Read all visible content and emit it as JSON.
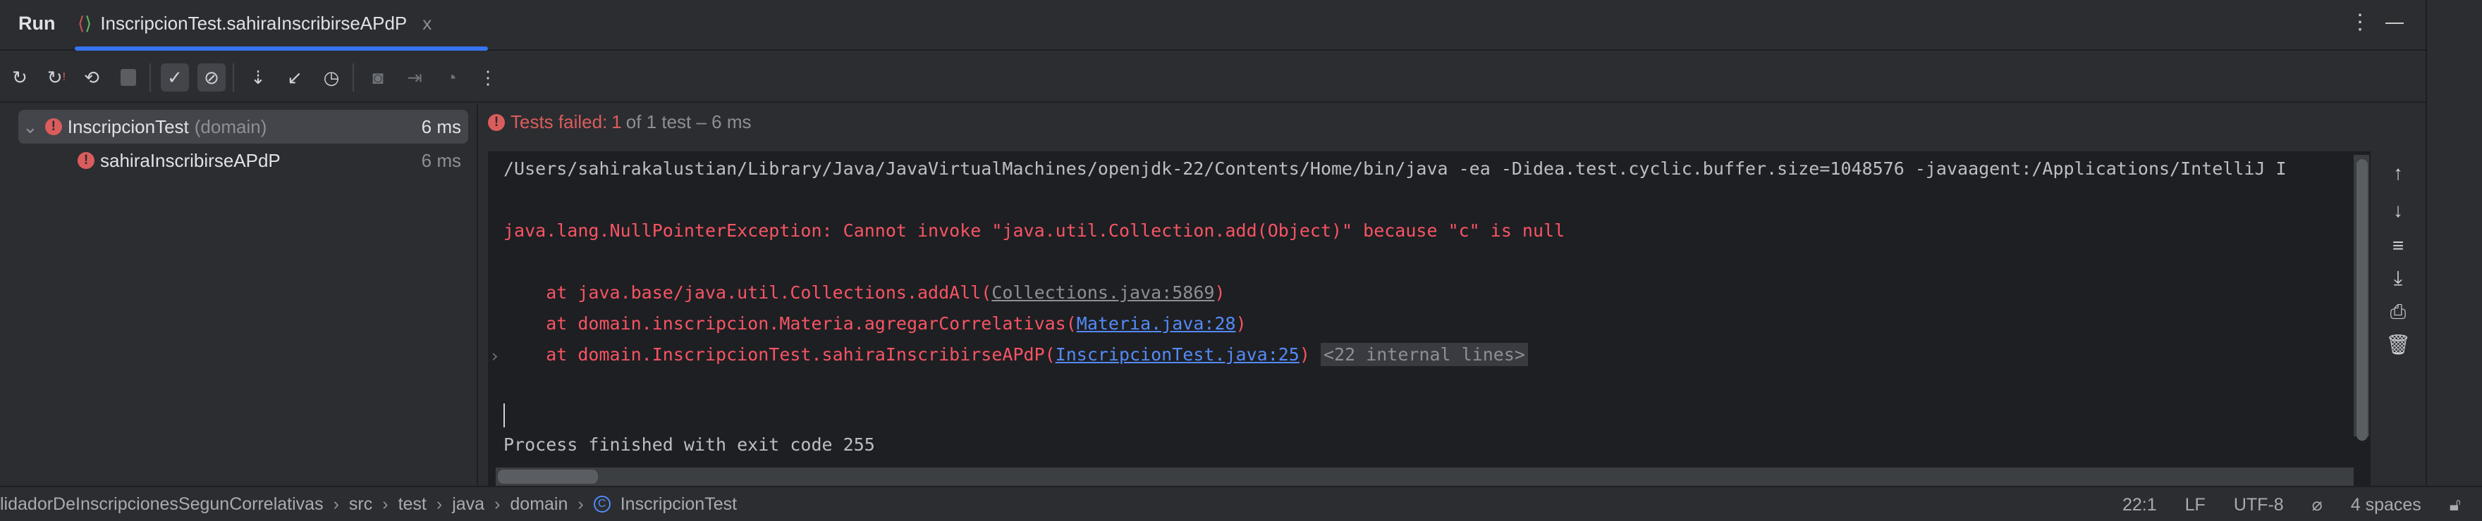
{
  "header": {
    "run_label": "Run",
    "tab_title": "InscripcionTest.sahiraInscribirseAPdP",
    "close": "x"
  },
  "toolbar": {
    "buttons": [
      "rerun-icon",
      "rerun-failed-icon",
      "toggle-auto-test-icon",
      "stop-icon",
      "show-passed-icon",
      "show-ignored-icon",
      "sort-alphabetically-icon",
      "collapse-icon",
      "sort-by-duration-icon",
      "camera-icon",
      "import-icon",
      "gauge-icon",
      "more-icon"
    ]
  },
  "tree": {
    "items": [
      {
        "name": "InscripcionTest",
        "package": "(domain)",
        "duration": "6 ms"
      },
      {
        "name": "sahiraInscribirseAPdP",
        "duration": "6 ms"
      }
    ]
  },
  "status": {
    "failed_label": "Tests failed:",
    "failed_count": "1",
    "rest": "of 1 test – 6 ms"
  },
  "console": {
    "command": "/Users/sahirakalustian/Library/Java/JavaVirtualMachines/openjdk-22/Contents/Home/bin/java -ea -Didea.test.cyclic.buffer.size=1048576 -javaagent:/Applications/IntelliJ I",
    "exception": "java.lang.NullPointerException: Cannot invoke \"java.util.Collection.add(Object)\" because \"c\" is null",
    "frames": [
      {
        "prefix": "    at java.base/java.util.Collections.addAll(",
        "link": "Collections.java:5869",
        "suffix": ")"
      },
      {
        "prefix": "    at domain.inscripcion.Materia.agregarCorrelativas(",
        "link": "Materia.java:28",
        "suffix": ")"
      },
      {
        "prefix": "    at domain.InscripcionTest.sahiraInscribirseAPdP(",
        "link": "InscripcionTest.java:25",
        "suffix": ")",
        "folded": "<22 internal lines>"
      }
    ],
    "finished": "Process finished with exit code 255"
  },
  "statusbar": {
    "breadcrumbs": [
      "lidadorDeInscripcionesSegunCorrelativas",
      "src",
      "test",
      "java",
      "domain",
      "InscripcionTest"
    ],
    "position": "22:1",
    "line_sep": "LF",
    "encoding": "UTF-8",
    "indent": "4 spaces"
  },
  "colors": {
    "accent": "#3574f0",
    "error": "#db5c5c",
    "console_red": "#f75464",
    "link": "#548af7"
  }
}
